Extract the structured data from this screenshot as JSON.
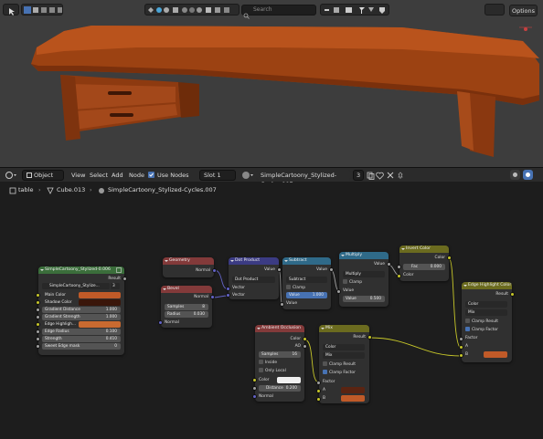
{
  "viewport": {
    "search_placeholder": "Search",
    "options_label": "Options"
  },
  "node_header": {
    "mode": "Object",
    "menu": [
      "View",
      "Select",
      "Add",
      "Node"
    ],
    "use_nodes_label": "Use Nodes",
    "slot": "Slot 1",
    "material": "SimpleCartoony_Stylized-Cycles.007",
    "user_count": "3"
  },
  "breadcrumb": {
    "object": "table",
    "mesh": "Cube.013",
    "material": "SimpleCartoony_Stylized-Cycles.007"
  },
  "colors": {
    "group_header": "#3b6e3b",
    "input_header": "#833a3a",
    "vector_header": "#3b3b83",
    "converter_header": "#2f6a89",
    "color_header": "#6b6b1f",
    "ao_header": "#833a3a",
    "mix_color_swatch": "#c05a28",
    "table_orange": "#b8501b"
  },
  "nodes": {
    "group": {
      "title": "SimpleCartoony_Stylized-0.006",
      "out": "Result",
      "datablock": "SimpleCartoony_Stylize...",
      "users": "3",
      "inputs": [
        {
          "label": "Main Color",
          "value": ""
        },
        {
          "label": "Shadow Color",
          "value": ""
        },
        {
          "label": "Gradient Distance",
          "value": "1.000"
        },
        {
          "label": "Gradient Strength",
          "value": "1.000"
        },
        {
          "label": "Edge Highligh...",
          "value": ""
        },
        {
          "label": "Edge Radius",
          "value": "0.100"
        },
        {
          "label": "Strength",
          "value": "0.410"
        },
        {
          "label": "Sweet Edge mask",
          "value": "0"
        }
      ]
    },
    "geometry": {
      "title": "Geometry",
      "out": "Normal"
    },
    "bevel": {
      "title": "Bevel",
      "out": "Normal",
      "samples_label": "Samples",
      "samples_value": "8",
      "radius_label": "Radius",
      "radius_value": "0.030",
      "in": "Normal"
    },
    "dot": {
      "title": "Dot Product",
      "out": "Value",
      "mode": "Dot Product",
      "in1": "Vector",
      "in2": "Vector"
    },
    "subtract": {
      "title": "Subtract",
      "out": "Value",
      "mode": "Subtract",
      "clamp": "Clamp",
      "value_label": "Value",
      "value": "1.000",
      "in": "Value"
    },
    "multiply": {
      "title": "Multiply",
      "out": "Value",
      "mode": "Multiply",
      "clamp": "Clamp",
      "in": "Value",
      "value_label": "Value",
      "value": "0.500"
    },
    "invert": {
      "title": "Invert Color",
      "out": "Color",
      "fac_label": "Fac",
      "fac_value": "0.000",
      "in": "Color"
    },
    "edge": {
      "title": "Edge Highlight Color",
      "out": "Result",
      "mode1": "Color",
      "mode2": "Mix",
      "clamp_result": "Clamp Result",
      "clamp_factor": "Clamp Factor",
      "factor": "Factor",
      "a": "A",
      "b": "B"
    },
    "ao": {
      "title": "Ambient Occlusion",
      "out1": "Color",
      "out2": "AO",
      "samples_label": "Samples",
      "samples_value": "16",
      "inside": "Inside",
      "only_local": "Only Local",
      "color": "Color",
      "distance_label": "Distance",
      "distance_value": "0.200",
      "normal": "Normal"
    },
    "mix": {
      "title": "Mix",
      "out": "Result",
      "mode1": "Color",
      "mode2": "Mix",
      "clamp_result": "Clamp Result",
      "clamp_factor": "Clamp Factor",
      "factor": "Factor",
      "a": "A",
      "b": "B"
    }
  }
}
